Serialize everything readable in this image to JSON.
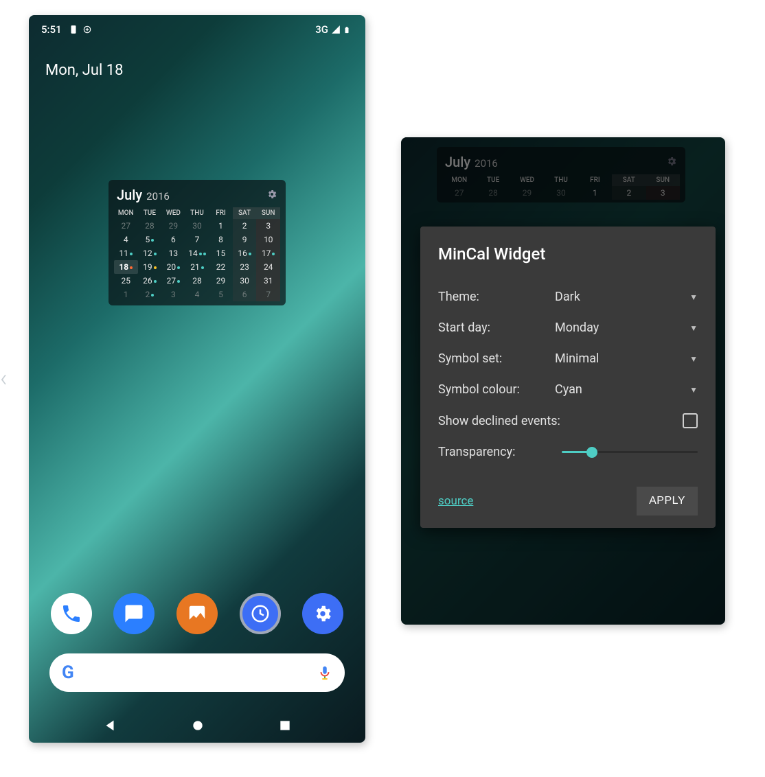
{
  "screen1": {
    "statusbar": {
      "time": "5:51",
      "net": "3G"
    },
    "date": "Mon, Jul 18",
    "widget": {
      "month": "July",
      "year": "2016",
      "dow": [
        "MON",
        "TUE",
        "WED",
        "THU",
        "FRI",
        "SAT",
        "SUN"
      ],
      "weeks": [
        [
          {
            "d": "27",
            "cls": "other"
          },
          {
            "d": "28",
            "cls": "other"
          },
          {
            "d": "29",
            "cls": "other"
          },
          {
            "d": "30",
            "cls": "other"
          },
          {
            "d": "1",
            "cls": ""
          },
          {
            "d": "2",
            "cls": "wkend"
          },
          {
            "d": "3",
            "cls": "sun"
          }
        ],
        [
          {
            "d": "4",
            "cls": ""
          },
          {
            "d": "5",
            "cls": "",
            "dots": [
              "c2"
            ]
          },
          {
            "d": "6",
            "cls": ""
          },
          {
            "d": "7",
            "cls": ""
          },
          {
            "d": "8",
            "cls": ""
          },
          {
            "d": "9",
            "cls": "wkend"
          },
          {
            "d": "10",
            "cls": "sun"
          }
        ],
        [
          {
            "d": "11",
            "cls": "",
            "dots": [
              "c2"
            ]
          },
          {
            "d": "12",
            "cls": "",
            "dots": [
              "c2"
            ]
          },
          {
            "d": "13",
            "cls": ""
          },
          {
            "d": "14",
            "cls": "",
            "dots": [
              "c2",
              "c2"
            ]
          },
          {
            "d": "15",
            "cls": ""
          },
          {
            "d": "16",
            "cls": "wkend",
            "dots": [
              "c2"
            ]
          },
          {
            "d": "17",
            "cls": "sun",
            "dots": [
              "c2"
            ]
          }
        ],
        [
          {
            "d": "18",
            "cls": "today",
            "dots": [
              "c1"
            ]
          },
          {
            "d": "19",
            "cls": "",
            "dots": [
              "c3"
            ]
          },
          {
            "d": "20",
            "cls": "",
            "dots": [
              "c2"
            ]
          },
          {
            "d": "21",
            "cls": "",
            "dots": [
              "c2"
            ]
          },
          {
            "d": "22",
            "cls": ""
          },
          {
            "d": "23",
            "cls": "wkend"
          },
          {
            "d": "24",
            "cls": "sun"
          }
        ],
        [
          {
            "d": "25",
            "cls": ""
          },
          {
            "d": "26",
            "cls": "",
            "dots": [
              "c2"
            ]
          },
          {
            "d": "27",
            "cls": "",
            "dots": [
              "c2"
            ]
          },
          {
            "d": "28",
            "cls": ""
          },
          {
            "d": "29",
            "cls": ""
          },
          {
            "d": "30",
            "cls": "wkend"
          },
          {
            "d": "31",
            "cls": "sun"
          }
        ],
        [
          {
            "d": "1",
            "cls": "other"
          },
          {
            "d": "2",
            "cls": "other",
            "dots": [
              "c2"
            ]
          },
          {
            "d": "3",
            "cls": "other"
          },
          {
            "d": "4",
            "cls": "other"
          },
          {
            "d": "5",
            "cls": "other"
          },
          {
            "d": "6",
            "cls": "other wkend"
          },
          {
            "d": "7",
            "cls": "other sun"
          }
        ]
      ]
    }
  },
  "screen2": {
    "widget": {
      "month": "July",
      "year": "2016",
      "dow": [
        "MON",
        "TUE",
        "WED",
        "THU",
        "FRI",
        "SAT",
        "SUN"
      ],
      "row": [
        {
          "d": "27",
          "cls": "other"
        },
        {
          "d": "28",
          "cls": "other"
        },
        {
          "d": "29",
          "cls": "other"
        },
        {
          "d": "30",
          "cls": "other"
        },
        {
          "d": "1",
          "cls": ""
        },
        {
          "d": "2",
          "cls": "wkend"
        },
        {
          "d": "3",
          "cls": "sun"
        }
      ]
    },
    "dialog": {
      "title": "MinCal Widget",
      "options": [
        {
          "label": "Theme:",
          "value": "Dark"
        },
        {
          "label": "Start day:",
          "value": "Monday"
        },
        {
          "label": "Symbol set:",
          "value": "Minimal"
        },
        {
          "label": "Symbol colour:",
          "value": "Cyan"
        }
      ],
      "checkbox": {
        "label": "Show declined events:",
        "checked": false
      },
      "slider": {
        "label": "Transparency:",
        "percent": 22
      },
      "source_link": "source",
      "apply": "APPLY"
    }
  }
}
